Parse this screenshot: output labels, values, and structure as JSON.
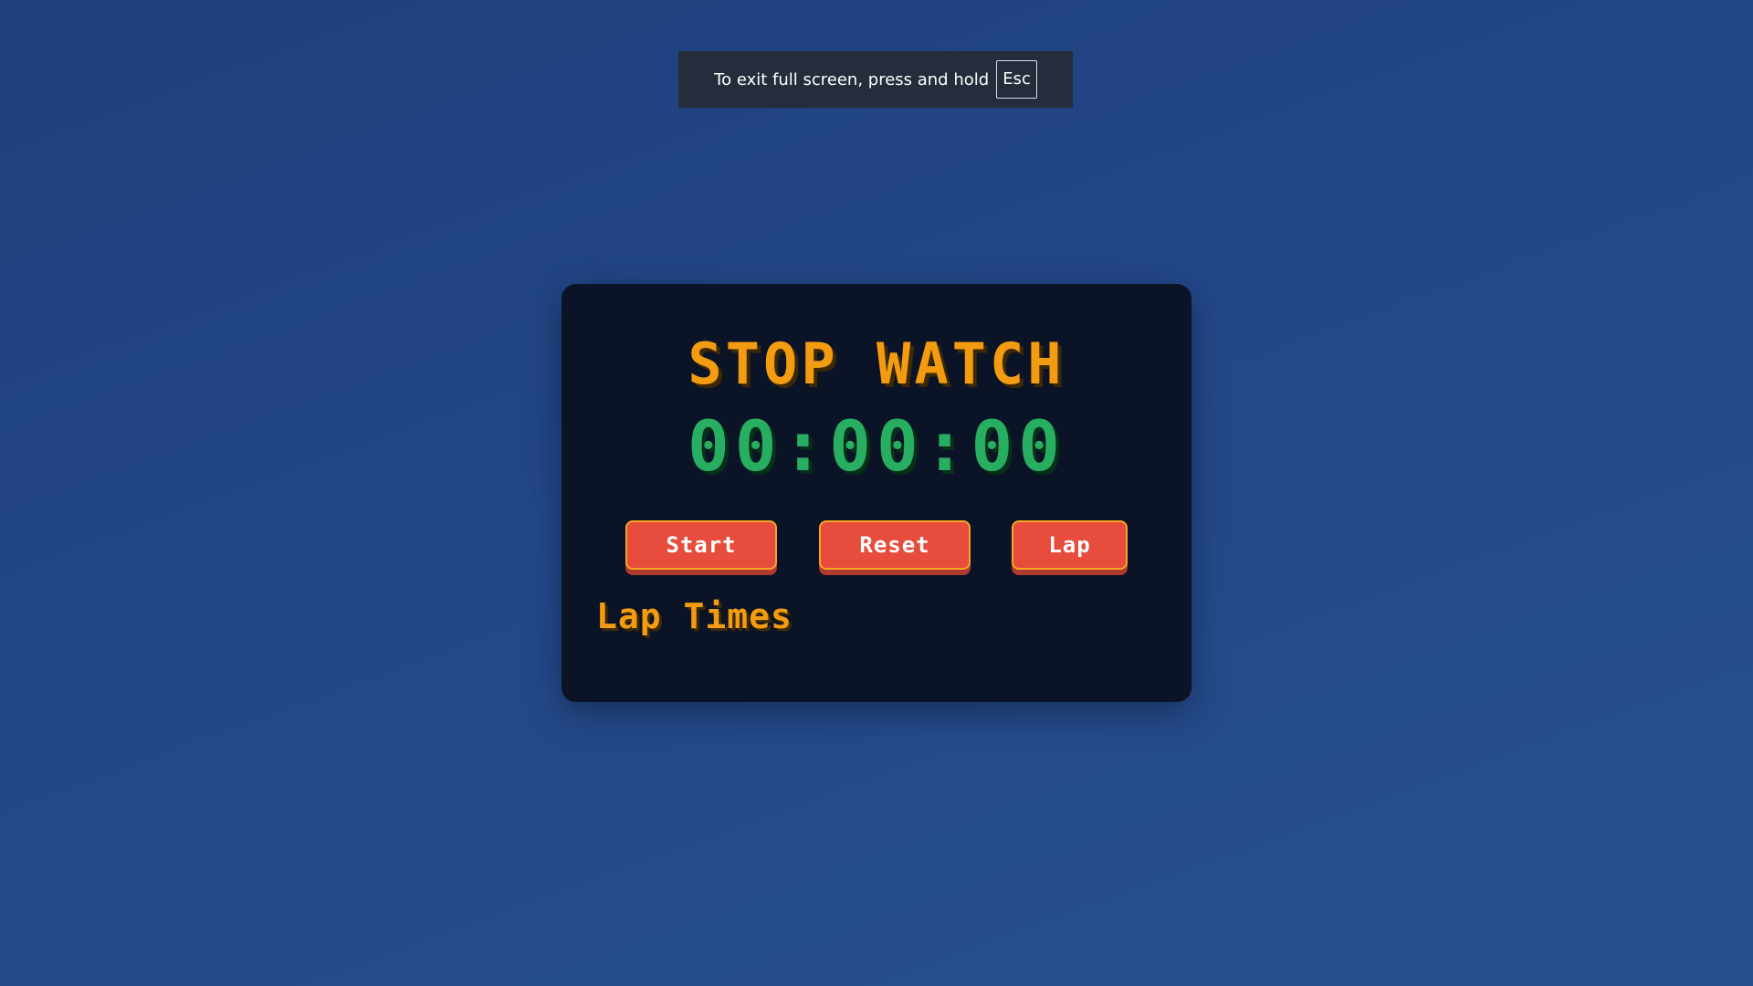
{
  "fullscreen_notice": {
    "text": "To exit full screen, press and hold",
    "key": "Esc"
  },
  "stopwatch": {
    "title": "STOP WATCH",
    "time": "00:00:00",
    "buttons": {
      "start": "Start",
      "reset": "Reset",
      "lap": "Lap"
    },
    "lap_times_title": "Lap Times",
    "laps": []
  },
  "colors": {
    "background": "#234789",
    "panel": "#0b1426",
    "title": "#f39c12",
    "time": "#27ae60",
    "button": "#e74c3c",
    "button_border": "#f5a623"
  }
}
